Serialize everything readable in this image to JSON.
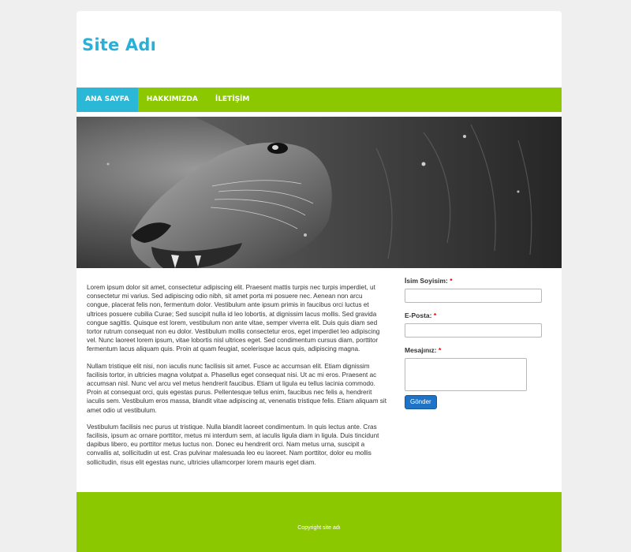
{
  "header": {
    "site_title": "Site Adı"
  },
  "nav": {
    "items": [
      {
        "label": "ANA SAYFA",
        "active": true
      },
      {
        "label": "HAKKIMIZDA",
        "active": false
      },
      {
        "label": "İLETİŞİM",
        "active": false
      }
    ]
  },
  "hero": {
    "image": "black-and-white-lion-roaring"
  },
  "content": {
    "paragraphs": [
      "Lorem ipsum dolor sit amet, consectetur adipiscing elit. Praesent mattis turpis nec turpis imperdiet, ut consectetur mi varius. Sed adipiscing odio nibh, sit amet porta mi posuere nec. Aenean non arcu congue, placerat felis non, fermentum dolor. Vestibulum ante ipsum primis in faucibus orci luctus et ultrices posuere cubilia Curae; Sed suscipit nulla id leo lobortis, at dignissim lacus mollis. Sed gravida congue sagittis. Quisque est lorem, vestibulum non ante vitae, semper viverra elit. Duis quis diam sed tortor rutrum consequat non eu dolor. Vestibulum mollis consectetur eros, eget imperdiet leo adipiscing vel. Nunc laoreet lorem ipsum, vitae lobortis nisl ultrices eget. Sed condimentum cursus diam, porttitor fermentum lacus aliquam quis. Proin at quam feugiat, scelerisque lacus quis, adipiscing magna.",
      "Nullam tristique elit nisi, non iaculis nunc facilisis sit amet. Fusce ac accumsan elit. Etiam dignissim facilisis tortor, in ultricies magna volutpat a. Phasellus eget consequat nisi. Ut ac mi eros. Praesent ac accumsan nisl. Nunc vel arcu vel metus hendrerit faucibus. Etiam ut ligula eu tellus lacinia commodo. Proin at consequat orci, quis egestas purus. Pellentesque tellus enim, faucibus nec felis a, hendrerit iaculis sem. Vestibulum eros massa, blandit vitae adipiscing at, venenatis tristique felis. Etiam aliquam sit amet odio ut vestibulum.",
      "Vestibulum facilisis nec purus ut tristique. Nulla blandit laoreet condimentum. In quis lectus ante. Cras facilisis, ipsum ac ornare porttitor, metus mi interdum sem, at iaculis ligula diam in ligula. Duis tincidunt dapibus libero, eu porttitor metus luctus non. Donec eu hendrerit orci. Nam metus urna, suscipit a convallis at, sollicitudin ut est. Cras pulvinar malesuada leo eu laoreet. Nam porttitor, dolor eu mollis sollicitudin, risus elit egestas nunc, ultricies ullamcorper lorem mauris eget diam."
    ]
  },
  "form": {
    "name_label": "İsim Soyisim:",
    "email_label": "E-Posta:",
    "message_label": "Mesajınız:",
    "required_mark": "*",
    "name_value": "",
    "email_value": "",
    "message_value": "",
    "submit_label": "Gönder"
  },
  "footer": {
    "copyright": "Copyright site adı"
  },
  "colors": {
    "accent_green": "#8cc800",
    "active_blue": "#2bb7d6",
    "title_blue": "#2ab0d8",
    "button_blue": "#1f73c6"
  }
}
